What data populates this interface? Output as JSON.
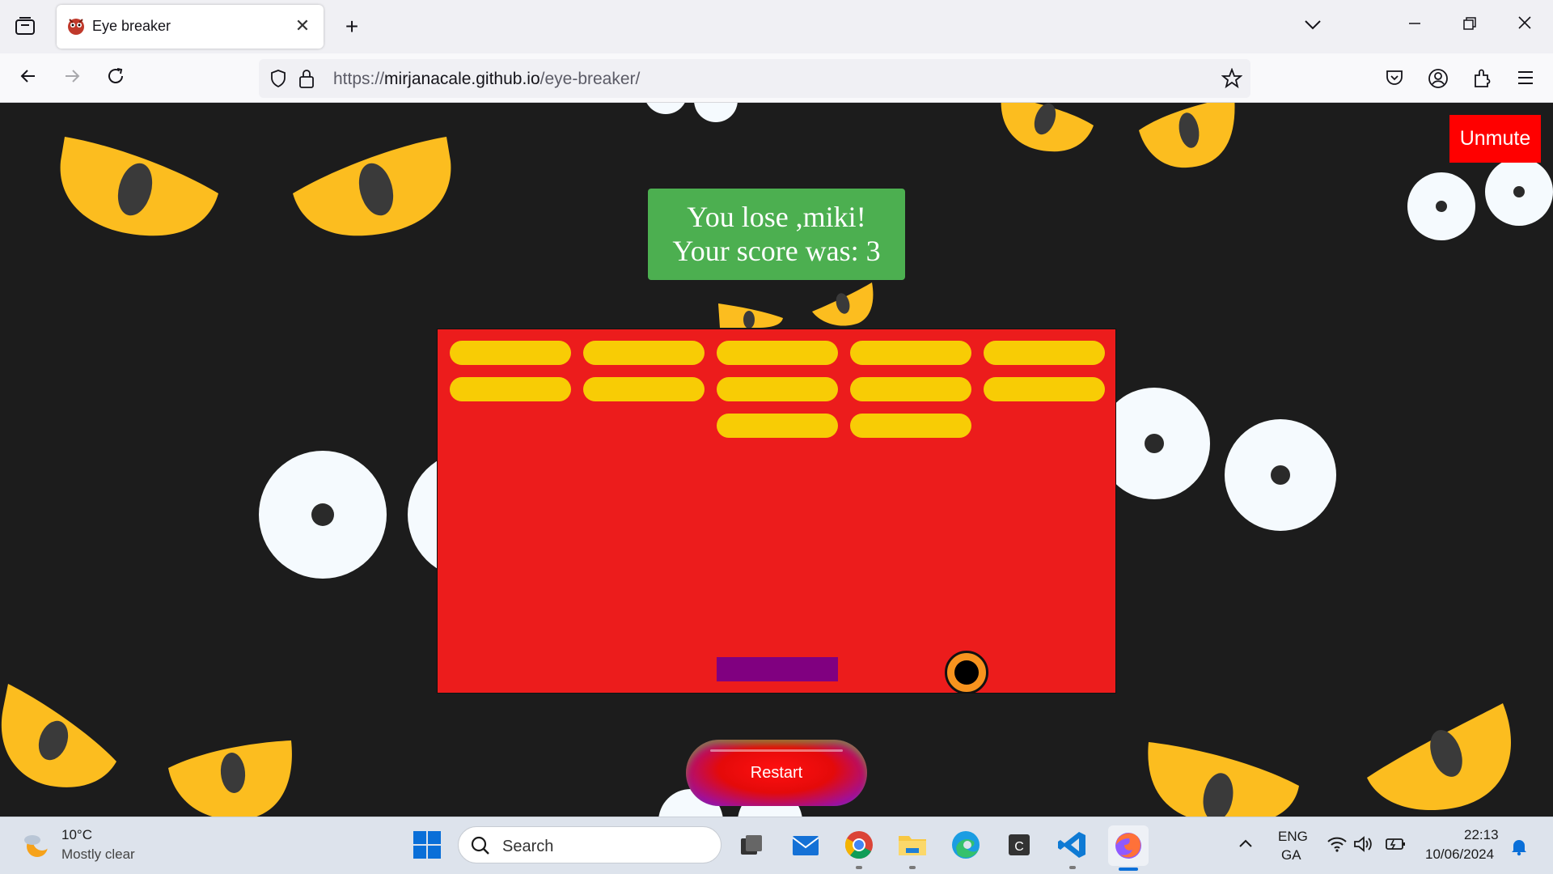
{
  "browser": {
    "tab_title": "Eye breaker",
    "url_prefix": "https://",
    "url_host": "mirjanacale.github.io",
    "url_path": "/eye-breaker/",
    "icons": [
      "tab-overview-icon",
      "close-icon",
      "plus-icon",
      "chevron-down-icon",
      "minimize-icon",
      "restore-icon",
      "close-window-icon",
      "back-icon",
      "forward-icon",
      "reload-icon",
      "shield-icon",
      "lock-icon",
      "star-icon",
      "pocket-icon",
      "account-icon",
      "extensions-icon",
      "menu-icon"
    ]
  },
  "game": {
    "unmute_label": "Unmute",
    "message_line1": "You lose ,miki!",
    "message_line2": "Your score was: 3",
    "restart_label": "Restart",
    "bricks_remaining": 12,
    "colors": {
      "background": "#1c1c1c",
      "board": "#ec1c1c",
      "brick": "#f8cc05",
      "paddle": "#800080",
      "ball": "#f7931e",
      "message_box": "#4caf50",
      "unmute": "#ff0000",
      "eye_yellow": "#fcbd1f",
      "eye_white": "#f5fafe"
    }
  },
  "taskbar": {
    "weather_temp": "10°C",
    "weather_desc": "Mostly clear",
    "search_placeholder": "Search",
    "language_line1": "ENG",
    "language_line2": "GA",
    "time": "22:13",
    "date": "10/06/2024",
    "apps": [
      "start-icon",
      "task-view-icon",
      "mail-icon",
      "chrome-icon",
      "file-explorer-icon",
      "edge-icon",
      "ccleaner-icon",
      "vscode-icon",
      "firefox-icon"
    ],
    "tray_icons": [
      "chevron-up-icon",
      "wifi-icon",
      "volume-icon",
      "battery-icon",
      "notification-bell-icon"
    ]
  }
}
